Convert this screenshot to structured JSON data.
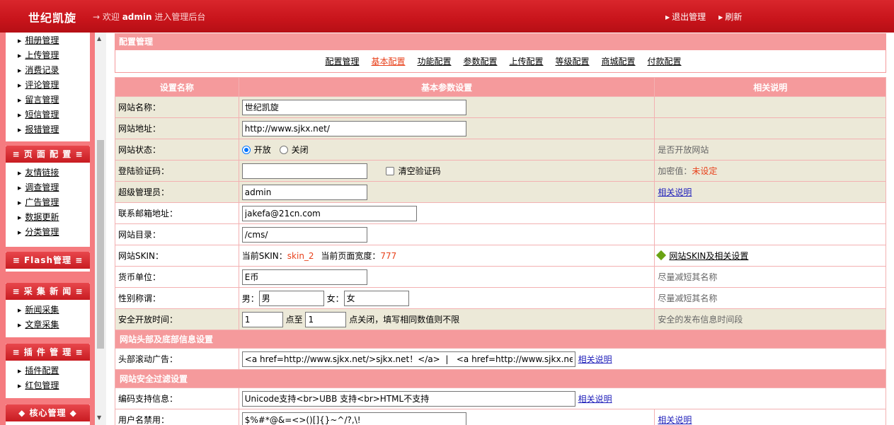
{
  "header": {
    "logo": "世纪凯旋",
    "welcome_prefix": "→ 欢迎",
    "user": "admin",
    "welcome_suffix": "进入管理后台",
    "logout": "退出管理",
    "refresh": "刷新"
  },
  "sidebar": {
    "group0": {
      "items": [
        "相册管理",
        "上传管理",
        "消费记录",
        "评论管理",
        "留言管理",
        "短信管理",
        "报错管理"
      ]
    },
    "group1": {
      "title": "≡ 页 面 配 置 ≡",
      "items": [
        "友情链接",
        "调查管理",
        "广告管理",
        "数据更新",
        "分类管理"
      ]
    },
    "group2": {
      "title": "≡ Flash管理 ≡"
    },
    "group3": {
      "title": "≡ 采 集 新 闻 ≡",
      "items": [
        "新闻采集",
        "文章采集"
      ]
    },
    "group4": {
      "title": "≡ 插 件 管 理 ≡",
      "items": [
        "插件配置",
        "红包管理"
      ]
    },
    "group5": {
      "title": "◆ 核心管理 ◆"
    }
  },
  "main": {
    "panel_title": "配置管理",
    "tabs": [
      "配置管理",
      "基本配置",
      "功能配置",
      "参数配置",
      "上传配置",
      "等级配置",
      "商城配置",
      "付款配置"
    ],
    "active_tab": "基本配置",
    "columns": [
      "设置名称",
      "基本参数设置",
      "相关说明"
    ]
  },
  "rows": {
    "site_name": {
      "label": "网站名称：",
      "value": "世纪凯旋"
    },
    "site_url": {
      "label": "网站地址：",
      "value": "http://www.sjkx.net/"
    },
    "site_status": {
      "label": "网站状态：",
      "opt_on": "开放",
      "opt_off": "关闭",
      "note": "是否开放网站"
    },
    "login_code": {
      "label": "登陆验证码：",
      "value": "",
      "clear": "清空验证码",
      "note_prefix": "加密值：",
      "note_value": "未设定"
    },
    "super_admin": {
      "label": "超级管理员：",
      "value": "admin",
      "note": "相关说明"
    },
    "email": {
      "label": "联系邮箱地址：",
      "value": "jakefa@21cn.com"
    },
    "site_dir": {
      "label": "网站目录：",
      "value": "/cms/"
    },
    "skin": {
      "label": "网站SKIN：",
      "current_label": "当前SKIN：",
      "current_value": "skin_2",
      "width_label": "当前页面宽度：",
      "width_value": "777",
      "note": "网站SKIN及相关设置"
    },
    "currency": {
      "label": "货币单位：",
      "value": "E币",
      "note": "尽量减短其名称"
    },
    "gender": {
      "label": "性别称谓：",
      "male_label": "男：",
      "male_value": "男",
      "female_label": "女：",
      "female_value": "女",
      "note": "尽量减短其名称"
    },
    "open_time": {
      "label": "安全开放时间：",
      "from": "1",
      "to_label": "点至",
      "to": "1",
      "suffix": "点关闭，填写相同数值则不限",
      "note": "安全的发布信息时间段"
    },
    "section_head": "网站头部及底部信息设置",
    "ticker": {
      "label": "头部滚动广告：",
      "value": "<a href=http://www.sjkx.net/>sjkx.net！</a>  |   <a href=http://www.sjkx.net/>www.sjkx.net</a>",
      "help": "相关说明"
    },
    "section_security": "网站安全过滤设置",
    "encoding": {
      "label": "编码支持信息：",
      "value": "Unicode支持<br>UBB 支持<br>HTML不支持",
      "help": "相关说明"
    },
    "banned_names": {
      "label": "用户名禁用：",
      "value": "$%#*@&=<>()[]{}~^/?,\\!",
      "note": "相关说明"
    }
  }
}
